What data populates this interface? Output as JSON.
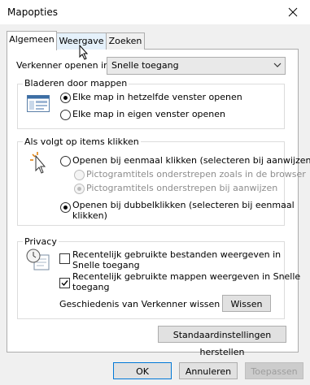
{
  "window": {
    "title": "Mapopties"
  },
  "tabs": [
    {
      "label": "Algemeen",
      "state": "active"
    },
    {
      "label": "Weergave",
      "state": "hover"
    },
    {
      "label": "Zoeken",
      "state": "normal"
    }
  ],
  "open_in": {
    "label": "Verkenner openen in:",
    "value": "Snelle toegang"
  },
  "browse_folders": {
    "title": "Bladeren door mappen",
    "options": [
      {
        "label": "Elke map in hetzelfde venster openen",
        "selected": true
      },
      {
        "label": "Elke map in eigen venster openen",
        "selected": false
      }
    ]
  },
  "click_items": {
    "title": "Als volgt op items klikken",
    "single_click": {
      "label": "Openen bij eenmaal klikken (selecteren bij aanwijzen)",
      "selected": false
    },
    "underline_browser": {
      "label": "Pictogramtitels onderstrepen zoals in de browser",
      "selected": false,
      "disabled": true
    },
    "underline_hover": {
      "label": "Pictogramtitels onderstrepen bij aanwijzen",
      "selected": true,
      "disabled": true
    },
    "double_click": {
      "line1": "Openen bij dubbelklikken (selecteren bij eenmaal",
      "line2": "klikken)",
      "selected": true
    }
  },
  "privacy": {
    "title": "Privacy",
    "recent_files": {
      "line1": "Recentelijk gebruikte bestanden weergeven in",
      "line2": "Snelle toegang",
      "checked": false
    },
    "recent_folders": {
      "line1": "Recentelijk gebruikte mappen weergeven in Snelle",
      "line2": "toegang",
      "checked": true
    },
    "clear_label": "Geschiedenis van Verkenner wissen",
    "clear_button": "Wissen"
  },
  "restore_defaults_button": "Standaardinstellingen herstellen",
  "footer": {
    "ok": "OK",
    "cancel": "Annuleren",
    "apply": "Toepassen"
  },
  "icons": {
    "close": "close-icon",
    "dropdown": "chevron-down-icon",
    "cursor": "mouse-pointer-icon"
  }
}
